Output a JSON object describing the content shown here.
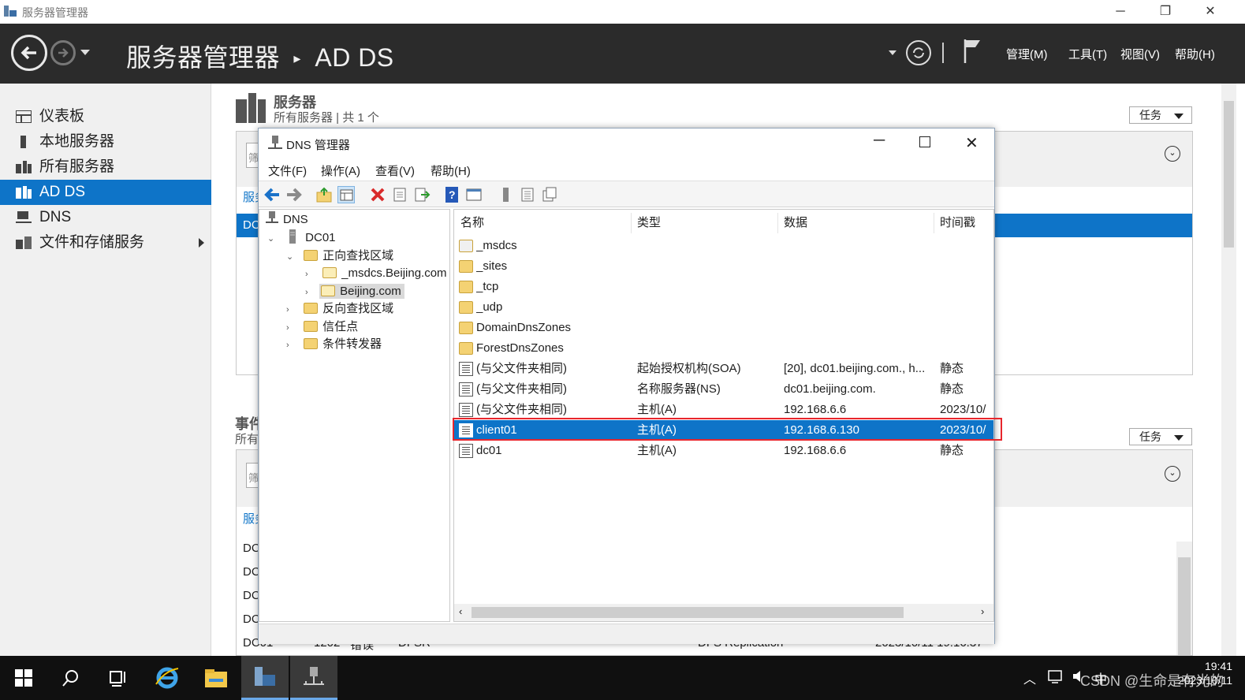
{
  "window": {
    "title": "服务器管理器"
  },
  "header": {
    "title": "服务器管理器",
    "breadcrumb_sep": "▸",
    "page": "AD DS",
    "menus": [
      "管理(M)",
      "工具(T)",
      "视图(V)",
      "帮助(H)"
    ]
  },
  "sidebar": {
    "items": [
      {
        "label": "仪表板"
      },
      {
        "label": "本地服务器"
      },
      {
        "label": "所有服务器"
      },
      {
        "label": "AD DS"
      },
      {
        "label": "DNS"
      },
      {
        "label": "文件和存储服务"
      }
    ]
  },
  "servers_panel": {
    "title": "服务器",
    "subtitle": "所有服务器 | 共 1 个",
    "tasks": "任务",
    "filter_placeholder": "筛",
    "col_prefix": "服务",
    "row_prefix": "DC"
  },
  "events_panel": {
    "title": "事件",
    "subtitle": "所有",
    "tasks": "任务",
    "filter_placeholder": "筛",
    "col_prefix": "服务",
    "row_prefix": "DC",
    "partial_row": {
      "server": "DC01",
      "id": "1202",
      "severity": "错误",
      "source": "DFSR",
      "category": "DFS Replication",
      "date": "2023/10/11 19:16:37"
    }
  },
  "dns": {
    "title": "DNS 管理器",
    "menus": [
      "文件(F)",
      "操作(A)",
      "查看(V)",
      "帮助(H)"
    ],
    "tree": [
      {
        "label": "DNS",
        "level": 0,
        "exp": ""
      },
      {
        "label": "DC01",
        "level": 1,
        "exp": "⌄"
      },
      {
        "label": "正向查找区域",
        "level": 2,
        "exp": "⌄"
      },
      {
        "label": "_msdcs.Beijing.com",
        "level": 3,
        "exp": "›"
      },
      {
        "label": "Beijing.com",
        "level": 3,
        "exp": "›",
        "selected": true
      },
      {
        "label": "反向查找区域",
        "level": 2,
        "exp": "›"
      },
      {
        "label": "信任点",
        "level": 2,
        "exp": "›"
      },
      {
        "label": "条件转发器",
        "level": 2,
        "exp": "›"
      }
    ],
    "columns": [
      "名称",
      "类型",
      "数据",
      "时间戳"
    ],
    "rows": [
      {
        "name": "_msdcs",
        "type": "",
        "data": "",
        "ts": "",
        "icon": "folder-zone"
      },
      {
        "name": "_sites",
        "type": "",
        "data": "",
        "ts": "",
        "icon": "folder"
      },
      {
        "name": "_tcp",
        "type": "",
        "data": "",
        "ts": "",
        "icon": "folder"
      },
      {
        "name": "_udp",
        "type": "",
        "data": "",
        "ts": "",
        "icon": "folder"
      },
      {
        "name": "DomainDnsZones",
        "type": "",
        "data": "",
        "ts": "",
        "icon": "folder"
      },
      {
        "name": "ForestDnsZones",
        "type": "",
        "data": "",
        "ts": "",
        "icon": "folder"
      },
      {
        "name": "(与父文件夹相同)",
        "type": "起始授权机构(SOA)",
        "data": "[20], dc01.beijing.com., h...",
        "ts": "静态",
        "icon": "record"
      },
      {
        "name": "(与父文件夹相同)",
        "type": "名称服务器(NS)",
        "data": "dc01.beijing.com.",
        "ts": "静态",
        "icon": "record"
      },
      {
        "name": "(与父文件夹相同)",
        "type": "主机(A)",
        "data": "192.168.6.6",
        "ts": "2023/10/",
        "icon": "record"
      },
      {
        "name": "client01",
        "type": "主机(A)",
        "data": "192.168.6.130",
        "ts": "2023/10/",
        "icon": "record",
        "selected": true
      },
      {
        "name": "dc01",
        "type": "主机(A)",
        "data": "192.168.6.6",
        "ts": "静态",
        "icon": "record"
      }
    ]
  },
  "highlight_color": "#e8262c",
  "accent_color": "#0e74c8",
  "taskbar": {
    "time": "19:41",
    "date": "2023/10/11",
    "ime": "中",
    "watermark": "CSDN @生命是有光的"
  }
}
